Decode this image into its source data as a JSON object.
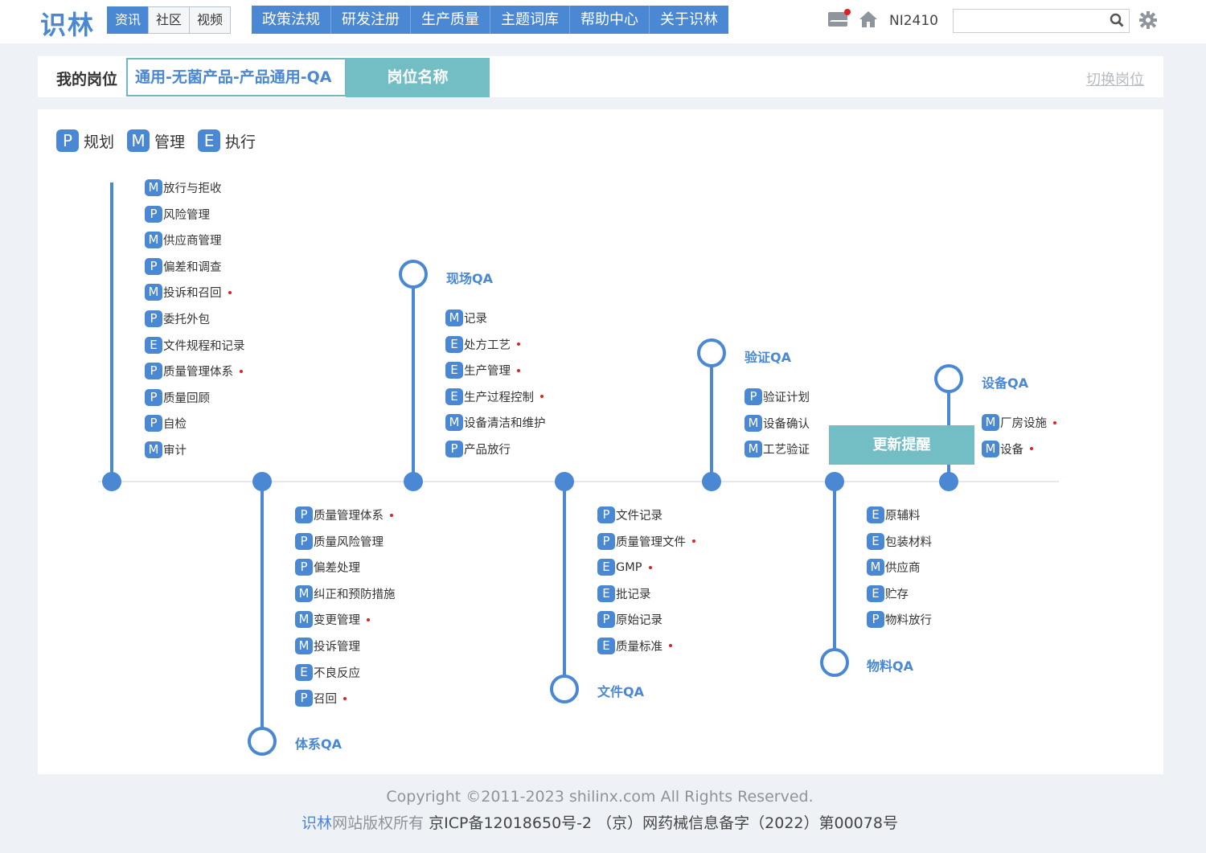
{
  "header": {
    "logo": "识林",
    "subtabs": [
      "资讯",
      "社区",
      "视频"
    ],
    "nav": [
      "政策法规",
      "研发注册",
      "生产质量",
      "主题词库",
      "帮助中心",
      "关于识林"
    ],
    "username": "NI2410",
    "search_placeholder": ""
  },
  "position": {
    "label": "我的岗位",
    "value": "通用-无菌产品-产品通用-QA",
    "button": "岗位名称",
    "switch_label": "切换岗位"
  },
  "legend": [
    {
      "badge": "P",
      "label": "规划"
    },
    {
      "badge": "M",
      "label": "管理"
    },
    {
      "badge": "E",
      "label": "执行"
    }
  ],
  "groups": {
    "top": {
      "items": [
        {
          "badge": "M",
          "text": "放行与拒收",
          "new": false
        },
        {
          "badge": "P",
          "text": "风险管理",
          "new": false
        },
        {
          "badge": "M",
          "text": "供应商管理",
          "new": false
        },
        {
          "badge": "P",
          "text": "偏差和调查",
          "new": false
        },
        {
          "badge": "M",
          "text": "投诉和召回",
          "new": true
        },
        {
          "badge": "P",
          "text": "委托外包",
          "new": false
        },
        {
          "badge": "E",
          "text": "文件规程和记录",
          "new": false
        },
        {
          "badge": "P",
          "text": "质量管理体系",
          "new": true
        },
        {
          "badge": "P",
          "text": "质量回顾",
          "new": false
        },
        {
          "badge": "P",
          "text": "自检",
          "new": false
        },
        {
          "badge": "M",
          "text": "审计",
          "new": false
        }
      ]
    },
    "tixi": {
      "title": "体系QA",
      "items": [
        {
          "badge": "P",
          "text": "质量管理体系",
          "new": true
        },
        {
          "badge": "P",
          "text": "质量风险管理",
          "new": false
        },
        {
          "badge": "P",
          "text": "偏差处理",
          "new": false
        },
        {
          "badge": "M",
          "text": "纠正和预防措施",
          "new": false
        },
        {
          "badge": "M",
          "text": "变更管理",
          "new": true
        },
        {
          "badge": "M",
          "text": "投诉管理",
          "new": false
        },
        {
          "badge": "E",
          "text": "不良反应",
          "new": false
        },
        {
          "badge": "P",
          "text": "召回",
          "new": true
        }
      ]
    },
    "xianchang": {
      "title": "现场QA",
      "items": [
        {
          "badge": "M",
          "text": "记录",
          "new": false
        },
        {
          "badge": "E",
          "text": "处方工艺",
          "new": true
        },
        {
          "badge": "E",
          "text": "生产管理",
          "new": true
        },
        {
          "badge": "E",
          "text": "生产过程控制",
          "new": true
        },
        {
          "badge": "M",
          "text": "设备清洁和维护",
          "new": false
        },
        {
          "badge": "P",
          "text": "产品放行",
          "new": false
        }
      ]
    },
    "wenjian": {
      "title": "文件QA",
      "items": [
        {
          "badge": "P",
          "text": "文件记录",
          "new": false
        },
        {
          "badge": "P",
          "text": "质量管理文件",
          "new": true
        },
        {
          "badge": "E",
          "text": "GMP",
          "new": true
        },
        {
          "badge": "E",
          "text": "批记录",
          "new": false
        },
        {
          "badge": "P",
          "text": "原始记录",
          "new": false
        },
        {
          "badge": "E",
          "text": "质量标准",
          "new": true
        }
      ]
    },
    "yanzheng": {
      "title": "验证QA",
      "items": [
        {
          "badge": "P",
          "text": "验证计划",
          "new": false
        },
        {
          "badge": "M",
          "text": "设备确认",
          "new": false
        },
        {
          "badge": "M",
          "text": "工艺验证",
          "new": true
        }
      ]
    },
    "wuliao": {
      "title": "物料QA",
      "items": [
        {
          "badge": "E",
          "text": "原辅料",
          "new": false
        },
        {
          "badge": "E",
          "text": "包装材料",
          "new": false
        },
        {
          "badge": "M",
          "text": "供应商",
          "new": false
        },
        {
          "badge": "E",
          "text": "贮存",
          "new": false
        },
        {
          "badge": "P",
          "text": "物料放行",
          "new": false
        }
      ]
    },
    "shebei": {
      "title": "设备QA",
      "items": [
        {
          "badge": "M",
          "text": "厂房设施",
          "new": true
        },
        {
          "badge": "M",
          "text": "设备",
          "new": true
        }
      ]
    }
  },
  "notice": "更新提醒",
  "footer": {
    "copyright": "Copyright ©2011-2023 shilinx.com All Rights Reserved.",
    "brand": "识林",
    "rights": "网站版权所有",
    "icp": "京ICP备12018650号-2 （京）网药械信息备字（2022）第00078号"
  },
  "colors": {
    "accent": "#4a88d4",
    "teal": "#73bec4",
    "new_dot": "#e02020"
  }
}
